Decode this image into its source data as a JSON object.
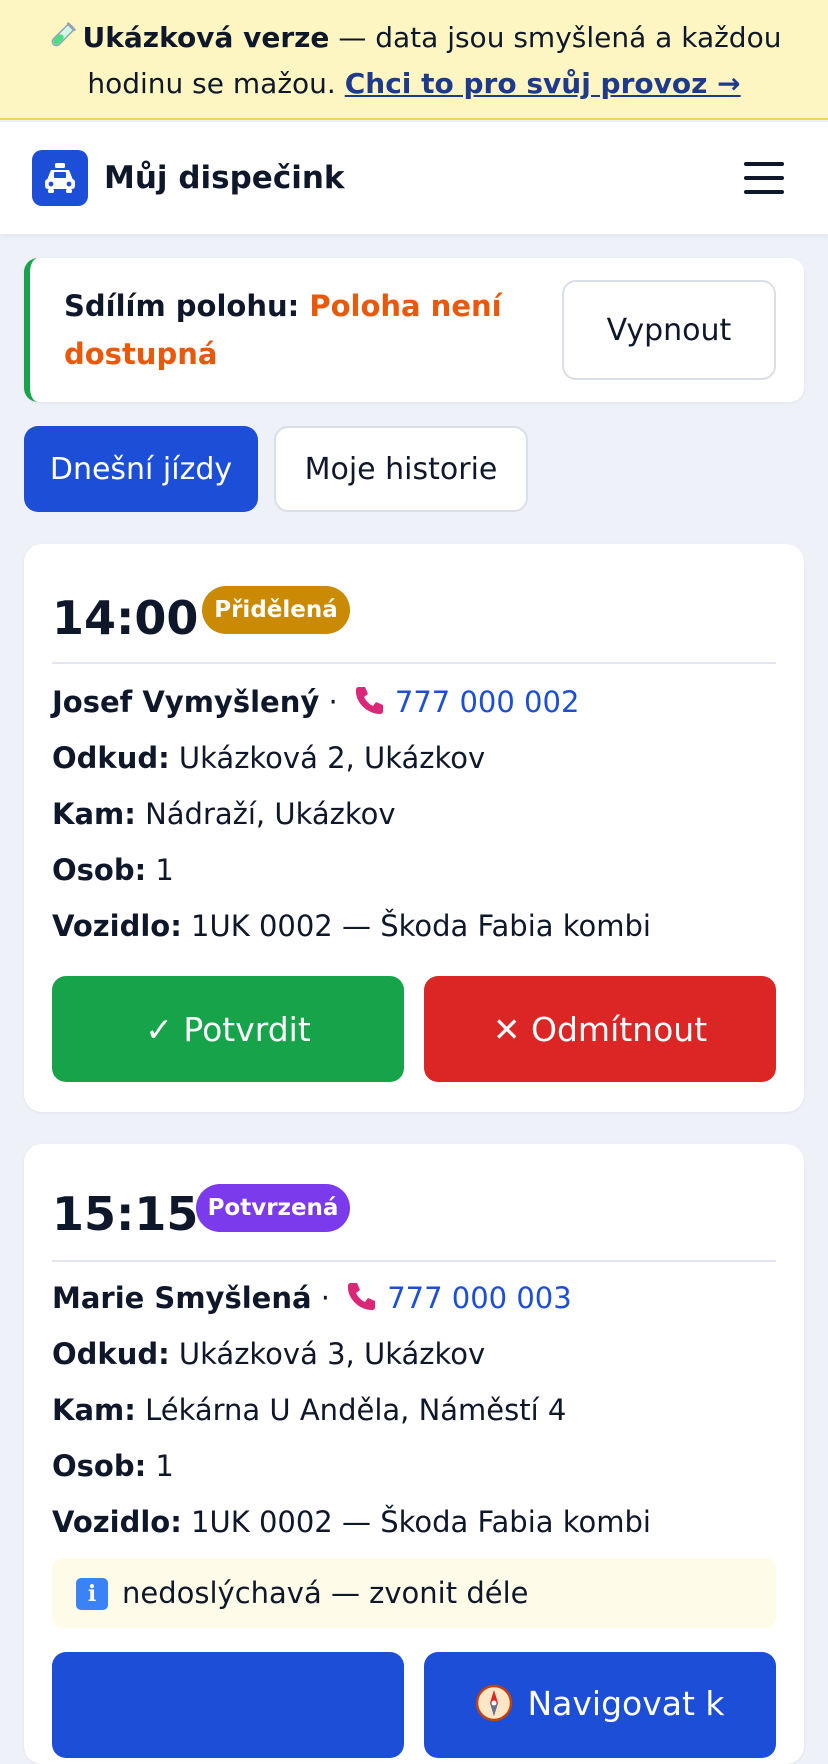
{
  "banner": {
    "icon": "test-tube-icon",
    "bold": "Ukázková verze",
    "text": " — data jsou smyšlená a každou hodinu se mažou. ",
    "link": "Chci to pro svůj provoz →"
  },
  "header": {
    "logo_icon": "taxi-icon",
    "title": "Můj dispečink",
    "menu_icon": "hamburger-menu-icon"
  },
  "location": {
    "label": "Sdílím polohu:",
    "status": "Poloha není dostupná",
    "button": "Vypnout",
    "accent": "#16a34a",
    "status_color": "#ea580c"
  },
  "tabs": [
    {
      "label": "Dnešní jízdy",
      "active": true
    },
    {
      "label": "Moje historie",
      "active": false
    }
  ],
  "rides": [
    {
      "time": "14:00",
      "status": "Přidělená",
      "status_color": "#ca8a04",
      "customer": "Josef Vymyšlený",
      "phone": "777 000 002",
      "from_label": "Odkud:",
      "from": "Ukázková 2, Ukázkov",
      "to_label": "Kam:",
      "to": "Nádraží, Ukázkov",
      "persons_label": "Osob:",
      "persons": "1",
      "vehicle_label": "Vozidlo:",
      "vehicle": "1UK 0002 — Škoda Fabia kombi",
      "actions": [
        "✓ Potvrdit",
        "✕ Odmítnout"
      ]
    },
    {
      "time": "15:15",
      "status": "Potvrzená",
      "status_color": "#7c3aed",
      "customer": "Marie Smyšlená",
      "phone": "777 000 003",
      "from_label": "Odkud:",
      "from": "Ukázková 3, Ukázkov",
      "to_label": "Kam:",
      "to": "Lékárna U Anděla, Náměstí 4",
      "persons_label": "Osob:",
      "persons": "1",
      "vehicle_label": "Vozidlo:",
      "vehicle": "1UK 0002 — Škoda Fabia kombi",
      "note_icon": "info-icon",
      "note": "nedoslýchavá — zvonit déle",
      "actions": [
        "",
        "Navigovat k"
      ],
      "nav_icon": "compass-icon"
    }
  ]
}
